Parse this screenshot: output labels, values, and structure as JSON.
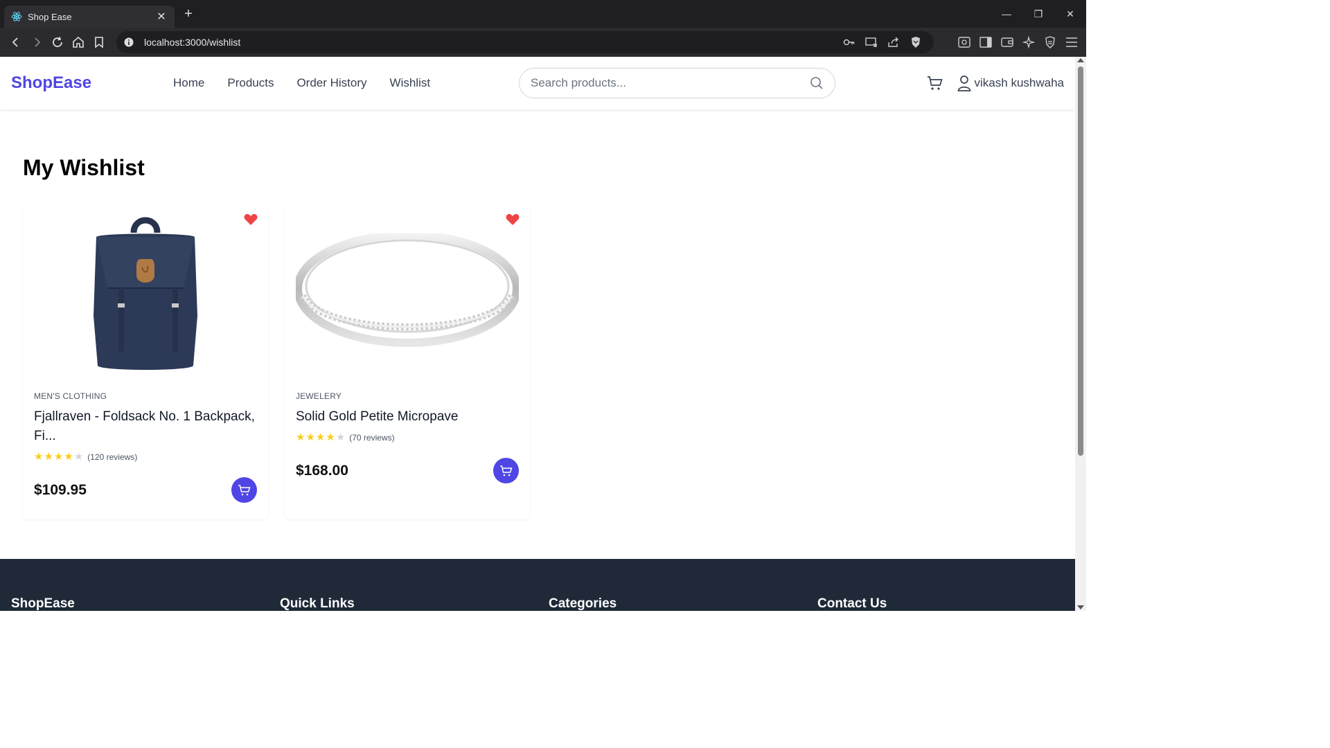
{
  "browser": {
    "tab_title": "Shop Ease",
    "url": "localhost:3000/wishlist"
  },
  "header": {
    "logo": "ShopEase",
    "nav": [
      "Home",
      "Products",
      "Order History",
      "Wishlist"
    ],
    "search_placeholder": "Search products...",
    "user_name": "vikash kushwaha"
  },
  "page": {
    "title": "My Wishlist"
  },
  "items": [
    {
      "category": "MEN'S CLOTHING",
      "title": "Fjallraven - Foldsack No. 1 Backpack, Fi...",
      "rating_stars": 4,
      "reviews": "(120 reviews)",
      "price": "$109.95"
    },
    {
      "category": "JEWELERY",
      "title": "Solid Gold Petite Micropave",
      "rating_stars": 4,
      "reviews": "(70 reviews)",
      "price": "$168.00"
    }
  ],
  "footer": {
    "brand": "ShopEase",
    "quick_links": "Quick Links",
    "categories": "Categories",
    "contact": "Contact Us"
  },
  "colors": {
    "accent": "#4f46e5",
    "heart": "#ef4444",
    "star": "#facc15",
    "footer_bg": "#1f2937"
  }
}
